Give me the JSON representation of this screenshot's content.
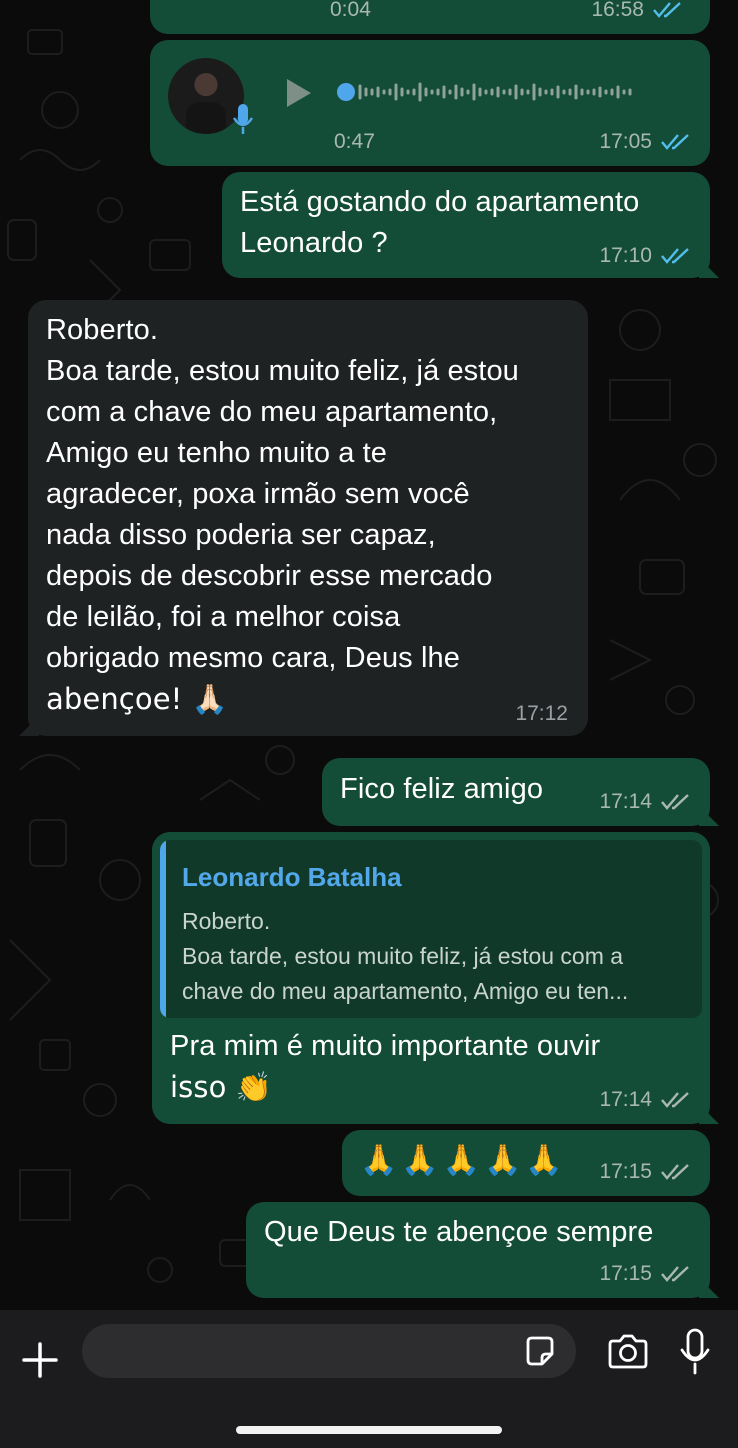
{
  "top_partial": {
    "duration": "0:04",
    "time": "16:58"
  },
  "voice": {
    "duration": "0:47",
    "time": "17:05",
    "status": "read"
  },
  "messages": [
    {
      "id": "m1",
      "direction": "out",
      "lines": [
        "Está gostando do apartamento",
        "Leonardo ?"
      ],
      "time": "17:10",
      "status": "read"
    },
    {
      "id": "m2",
      "direction": "in",
      "lines": [
        "Roberto.",
        "Boa tarde, estou muito feliz, já estou",
        "com a chave do meu apartamento,",
        "Amigo eu tenho muito a te",
        "agradecer, poxa irmão sem você",
        "nada disso poderia ser capaz,",
        "depois de descobrir esse mercado",
        "de leilão, foi a melhor coisa",
        "obrigado mesmo cara, Deus lhe",
        "abençoe! 🙏🏻"
      ],
      "time": "17:12"
    },
    {
      "id": "m3",
      "direction": "out",
      "lines": [
        "Fico feliz amigo"
      ],
      "time": "17:14",
      "status": "delivered"
    },
    {
      "id": "m4",
      "direction": "out",
      "quote": {
        "author": "Leonardo Batalha",
        "lines": [
          "Roberto.",
          "Boa tarde, estou muito feliz, já estou com a",
          "chave do meu apartamento, Amigo eu ten..."
        ]
      },
      "lines": [
        "Pra mim é muito importante ouvir",
        "isso 👏"
      ],
      "time": "17:14",
      "status": "delivered"
    },
    {
      "id": "m5",
      "direction": "out",
      "lines": [
        "🙏🙏🙏🙏🙏"
      ],
      "time": "17:15",
      "status": "delivered"
    },
    {
      "id": "m6",
      "direction": "out",
      "lines": [
        "Que Deus te abençoe sempre"
      ],
      "time": "17:15",
      "status": "delivered"
    }
  ],
  "colors": {
    "outgoing_bubble": "#144d37",
    "incoming_bubble": "#1f2223",
    "read_ticks": "#53bdeb",
    "delivered_ticks": "#a8b8b0",
    "quote_author": "#53a8ea"
  },
  "input_bar": {
    "placeholder": "",
    "icons": [
      "plus-icon",
      "sticker-icon",
      "camera-icon",
      "microphone-icon"
    ]
  }
}
